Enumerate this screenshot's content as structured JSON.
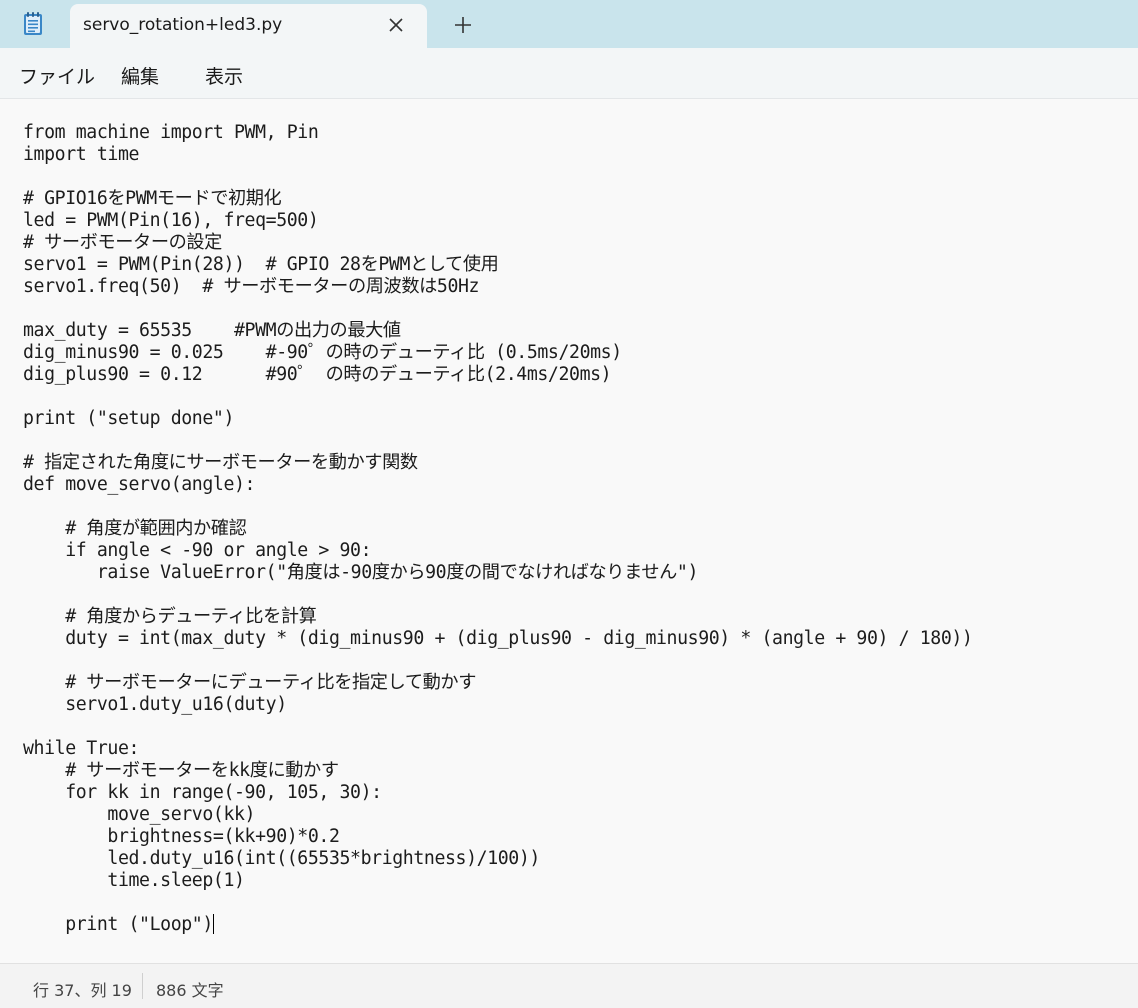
{
  "tab": {
    "title": "servo_rotation+led3.py",
    "close_glyph": "✕",
    "new_tab_glyph": "+"
  },
  "icons": {
    "app": "notepad-icon",
    "close": "close-icon",
    "new_tab": "plus-icon"
  },
  "menu": {
    "file": "ファイル",
    "edit": "編集",
    "view": "表示"
  },
  "editor": {
    "content": "from machine import PWM, Pin\nimport time\n\n# GPIO16をPWMモードで初期化\nled = PWM(Pin(16), freq=500)\n# サーボモーターの設定\nservo1 = PWM(Pin(28))  # GPIO 28をPWMとして使用\nservo1.freq(50)  # サーボモーターの周波数は50Hz\n\nmax_duty = 65535    #PWMの出力の最大値\ndig_minus90 = 0.025    #-90゜の時のデューティ比 (0.5ms/20ms)\ndig_plus90 = 0.12      #90゜ の時のデューティ比(2.4ms/20ms)\n\nprint (\"setup done\")\n\n# 指定された角度にサーボモーターを動かす関数\ndef move_servo(angle):\n\n    # 角度が範囲内か確認\n    if angle < -90 or angle > 90:\n       raise ValueError(\"角度は-90度から90度の間でなければなりません\")\n\n    # 角度からデューティ比を計算\n    duty = int(max_duty * (dig_minus90 + (dig_plus90 - dig_minus90) * (angle + 90) / 180))\n\n    # サーボモーターにデューティ比を指定して動かす\n    servo1.duty_u16(duty)\n\nwhile True:\n    # サーボモーターをkk度に動かす\n    for kk in range(-90, 105, 30):\n        move_servo(kk)\n        brightness=(kk+90)*0.2\n        led.duty_u16(int((65535*brightness)/100))\n        time.sleep(1)\n\n    print (\"Loop\")"
  },
  "status": {
    "position": "行 37、列 19",
    "char_count": "886 文字"
  },
  "colors": {
    "titlebar_bg": "#c9e4ec",
    "tab_bg": "#f3f6f7",
    "editor_bg": "#f9f9f9",
    "statusbar_bg": "#f3f3f3",
    "text": "#1c1c1c"
  }
}
